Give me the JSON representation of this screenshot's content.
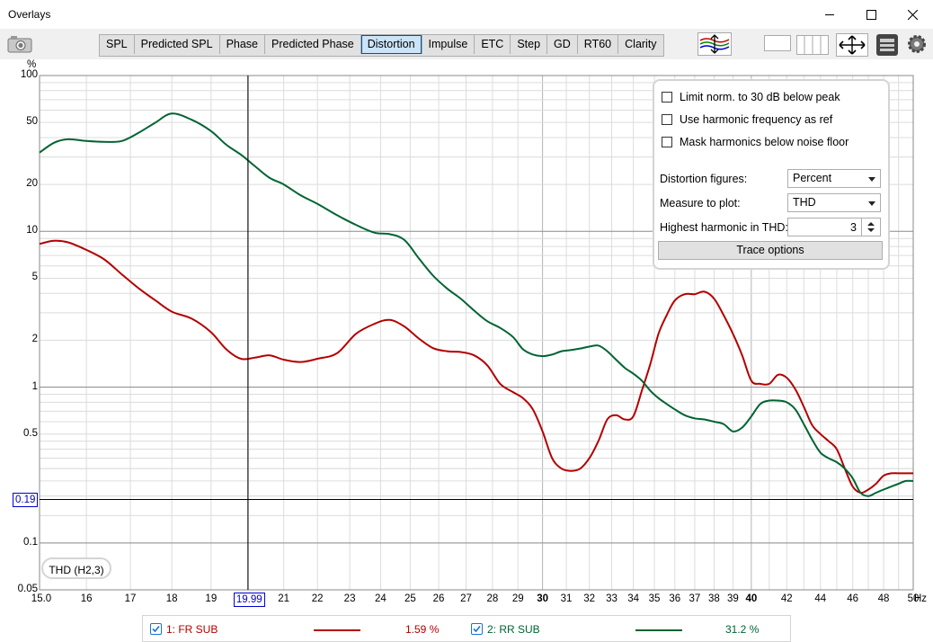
{
  "window": {
    "title": "Overlays"
  },
  "tabs": [
    {
      "label": "SPL",
      "active": false
    },
    {
      "label": "Predicted SPL",
      "active": false
    },
    {
      "label": "Phase",
      "active": false
    },
    {
      "label": "Predicted Phase",
      "active": false
    },
    {
      "label": "Distortion",
      "active": true
    },
    {
      "label": "Impulse",
      "active": false
    },
    {
      "label": "ETC",
      "active": false
    },
    {
      "label": "Step",
      "active": false
    },
    {
      "label": "GD",
      "active": false
    },
    {
      "label": "RT60",
      "active": false
    },
    {
      "label": "Clarity",
      "active": false
    }
  ],
  "toolbar_icons": [
    "camera-icon",
    "overlay-arrange-icon",
    "blank-panel-icon",
    "columns-icon",
    "move-arrows-icon",
    "layout-icon",
    "gear-icon"
  ],
  "options_panel": {
    "checkboxes": [
      {
        "label": "Limit norm. to 30 dB below peak",
        "checked": false
      },
      {
        "label": "Use harmonic frequency as ref",
        "checked": false
      },
      {
        "label": "Mask harmonics below noise floor",
        "checked": false
      }
    ],
    "distortion_figures": {
      "label": "Distortion figures:",
      "value": "Percent"
    },
    "measure_to_plot": {
      "label": "Measure to plot:",
      "value": "THD"
    },
    "highest_harmonic": {
      "label": "Highest harmonic in THD:",
      "value": "3"
    },
    "trace_options_label": "Trace options"
  },
  "plot_label": "THD (H2,3)",
  "cursor": {
    "x_readout": "19.99",
    "y_readout": "0.19"
  },
  "legend": [
    {
      "label": "1: FR SUB",
      "value": "1.59 %",
      "color": "#b40000",
      "checked": true
    },
    {
      "label": "2: RR SUB",
      "value": "31.2 %",
      "color": "#006432",
      "checked": true
    }
  ],
  "chart_data": {
    "type": "line",
    "ylabel": "%",
    "xunit": "Hz",
    "y_scale": "log",
    "x_scale": "log",
    "xlim": [
      15,
      50
    ],
    "ylim": [
      0.05,
      100
    ],
    "yticks": [
      {
        "value": 100,
        "label": "100"
      },
      {
        "value": 50,
        "label": "50"
      },
      {
        "value": 20,
        "label": "20"
      },
      {
        "value": 10,
        "label": "10"
      },
      {
        "value": 5,
        "label": "5"
      },
      {
        "value": 2,
        "label": "2"
      },
      {
        "value": 1,
        "label": "1"
      },
      {
        "value": 0.5,
        "label": "0.5"
      },
      {
        "value": 0.1,
        "label": "0.1"
      },
      {
        "value": 0.05,
        "label": "0.05"
      }
    ],
    "xticks": [
      {
        "value": 15,
        "label": "15.0",
        "bold": false
      },
      {
        "value": 16,
        "label": "16",
        "bold": false
      },
      {
        "value": 17,
        "label": "17",
        "bold": false
      },
      {
        "value": 18,
        "label": "18",
        "bold": false
      },
      {
        "value": 19,
        "label": "19",
        "bold": false
      },
      {
        "value": 21,
        "label": "21",
        "bold": false
      },
      {
        "value": 22,
        "label": "22",
        "bold": false
      },
      {
        "value": 23,
        "label": "23",
        "bold": false
      },
      {
        "value": 24,
        "label": "24",
        "bold": false
      },
      {
        "value": 25,
        "label": "25",
        "bold": false
      },
      {
        "value": 26,
        "label": "26",
        "bold": false
      },
      {
        "value": 27,
        "label": "27",
        "bold": false
      },
      {
        "value": 28,
        "label": "28",
        "bold": false
      },
      {
        "value": 29,
        "label": "29",
        "bold": false
      },
      {
        "value": 30,
        "label": "30",
        "bold": true
      },
      {
        "value": 31,
        "label": "31",
        "bold": false
      },
      {
        "value": 32,
        "label": "32",
        "bold": false
      },
      {
        "value": 33,
        "label": "33",
        "bold": false
      },
      {
        "value": 34,
        "label": "34",
        "bold": false
      },
      {
        "value": 35,
        "label": "35",
        "bold": false
      },
      {
        "value": 36,
        "label": "36",
        "bold": false
      },
      {
        "value": 37,
        "label": "37",
        "bold": false
      },
      {
        "value": 38,
        "label": "38",
        "bold": false
      },
      {
        "value": 39,
        "label": "39",
        "bold": false
      },
      {
        "value": 40,
        "label": "40",
        "bold": true
      },
      {
        "value": 42,
        "label": "42",
        "bold": false
      },
      {
        "value": 44,
        "label": "44",
        "bold": false
      },
      {
        "value": 46,
        "label": "46",
        "bold": false
      },
      {
        "value": 48,
        "label": "48",
        "bold": false
      },
      {
        "value": 50,
        "label": "50",
        "bold": false
      }
    ],
    "cursor_x": 19.99,
    "cursor_y": 0.19,
    "grid": true,
    "series": [
      {
        "name": "1: FR SUB",
        "color": "#b40000",
        "x": [
          15.0,
          15.3,
          15.6,
          16.0,
          16.4,
          16.8,
          17.2,
          17.6,
          18.0,
          18.5,
          19.0,
          19.4,
          19.8,
          20.2,
          20.6,
          21.0,
          21.5,
          22.0,
          22.6,
          23.2,
          23.8,
          24.3,
          24.8,
          25.3,
          25.8,
          26.3,
          26.8,
          27.3,
          27.8,
          28.3,
          28.8,
          29.2,
          29.6,
          30.0,
          30.4,
          30.8,
          31.2,
          31.6,
          32.0,
          32.4,
          32.8,
          33.2,
          33.6,
          34.0,
          34.4,
          34.8,
          35.2,
          35.6,
          36.0,
          36.5,
          37.0,
          37.5,
          38.0,
          38.5,
          39.0,
          39.5,
          40.0,
          40.5,
          41.0,
          41.5,
          42.0,
          42.5,
          43.0,
          43.5,
          44.0,
          44.5,
          45.0,
          45.5,
          46.0,
          46.5,
          47.0,
          47.5,
          48.0,
          48.5,
          49.0,
          49.5,
          50.0
        ],
        "y": [
          8.3,
          8.7,
          8.5,
          7.6,
          6.6,
          5.3,
          4.3,
          3.6,
          3.05,
          2.75,
          2.25,
          1.75,
          1.52,
          1.55,
          1.6,
          1.5,
          1.45,
          1.52,
          1.65,
          2.2,
          2.55,
          2.7,
          2.45,
          2.05,
          1.78,
          1.7,
          1.68,
          1.6,
          1.38,
          1.05,
          0.93,
          0.85,
          0.72,
          0.52,
          0.35,
          0.3,
          0.29,
          0.3,
          0.35,
          0.45,
          0.62,
          0.66,
          0.62,
          0.65,
          0.95,
          1.4,
          2.2,
          2.9,
          3.6,
          3.95,
          3.95,
          4.1,
          3.7,
          2.9,
          2.2,
          1.6,
          1.1,
          1.05,
          1.05,
          1.2,
          1.15,
          0.97,
          0.75,
          0.57,
          0.5,
          0.45,
          0.4,
          0.3,
          0.23,
          0.21,
          0.22,
          0.24,
          0.27,
          0.28,
          0.28,
          0.28,
          0.28
        ]
      },
      {
        "name": "2: RR SUB",
        "color": "#006432",
        "x": [
          15.0,
          15.3,
          15.6,
          16.0,
          16.4,
          16.8,
          17.2,
          17.6,
          18.0,
          18.5,
          19.0,
          19.4,
          19.8,
          20.2,
          20.6,
          21.0,
          21.5,
          22.0,
          22.6,
          23.2,
          23.8,
          24.3,
          24.8,
          25.3,
          25.8,
          26.3,
          26.8,
          27.3,
          27.8,
          28.3,
          28.8,
          29.2,
          29.6,
          30.0,
          30.4,
          30.8,
          31.2,
          31.6,
          32.0,
          32.4,
          32.8,
          33.2,
          33.6,
          34.0,
          34.4,
          34.8,
          35.2,
          35.6,
          36.0,
          36.5,
          37.0,
          37.5,
          38.0,
          38.5,
          39.0,
          39.5,
          40.0,
          40.5,
          41.0,
          41.5,
          42.0,
          42.5,
          43.0,
          43.5,
          44.0,
          44.5,
          45.0,
          45.5,
          46.0,
          46.5,
          47.0,
          47.5,
          48.0,
          48.5,
          49.0,
          49.5,
          50.0
        ],
        "y": [
          32,
          37,
          39,
          38,
          37.5,
          38,
          43,
          50,
          57,
          52,
          44,
          36,
          31,
          26,
          22,
          20,
          17,
          15,
          12.7,
          11,
          9.8,
          9.6,
          8.8,
          6.7,
          5.2,
          4.3,
          3.7,
          3.1,
          2.65,
          2.4,
          2.1,
          1.75,
          1.62,
          1.58,
          1.62,
          1.7,
          1.73,
          1.77,
          1.82,
          1.85,
          1.7,
          1.5,
          1.33,
          1.22,
          1.1,
          0.95,
          0.85,
          0.78,
          0.72,
          0.66,
          0.63,
          0.62,
          0.6,
          0.58,
          0.52,
          0.55,
          0.65,
          0.78,
          0.82,
          0.82,
          0.8,
          0.72,
          0.58,
          0.46,
          0.38,
          0.35,
          0.33,
          0.3,
          0.26,
          0.21,
          0.2,
          0.21,
          0.22,
          0.23,
          0.24,
          0.25,
          0.25
        ]
      }
    ]
  }
}
